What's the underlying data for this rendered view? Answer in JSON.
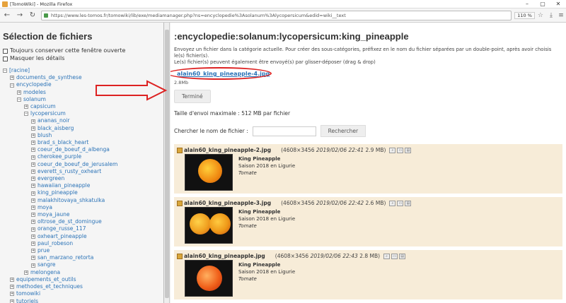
{
  "browser": {
    "title": "[TomoWiki] - Mozilla Firefox",
    "url": "https://www.les-tomos.fr/tomowiki/lib/exe/mediamanager.php?ns=encyclopedie%3Asolanum%3Alycopersicum&edid=wiki__text",
    "zoom": "110 %"
  },
  "left": {
    "title": "Sélection de fichiers",
    "opt1": "Toujours conserver cette fenêtre ouverte",
    "opt2": "Masquer les détails",
    "tree": [
      {
        "label": "[racine]",
        "level": 0,
        "exp": "−"
      },
      {
        "label": "documents_de_synthese",
        "level": 1,
        "exp": "+"
      },
      {
        "label": "encyclopedie",
        "level": 1,
        "exp": "−"
      },
      {
        "label": "modeles",
        "level": 2,
        "exp": "+"
      },
      {
        "label": "solanum",
        "level": 2,
        "exp": "−"
      },
      {
        "label": "capsicum",
        "level": 3,
        "exp": "+"
      },
      {
        "label": "lycopersicum",
        "level": 3,
        "exp": "−"
      },
      {
        "label": "ananas_noir",
        "level": 4,
        "exp": "+"
      },
      {
        "label": "black_aisberg",
        "level": 4,
        "exp": "+"
      },
      {
        "label": "blush",
        "level": 4,
        "exp": "+"
      },
      {
        "label": "brad_s_black_heart",
        "level": 4,
        "exp": "+"
      },
      {
        "label": "coeur_de_boeuf_d_albenga",
        "level": 4,
        "exp": "+"
      },
      {
        "label": "cherokee_purple",
        "level": 4,
        "exp": "+"
      },
      {
        "label": "coeur_de_boeuf_de_jerusalem",
        "level": 4,
        "exp": "+"
      },
      {
        "label": "everett_s_rusty_oxheart",
        "level": 4,
        "exp": "+"
      },
      {
        "label": "evergreen",
        "level": 4,
        "exp": "+"
      },
      {
        "label": "hawaiian_pineapple",
        "level": 4,
        "exp": "+"
      },
      {
        "label": "king_pineapple",
        "level": 4,
        "exp": "+"
      },
      {
        "label": "malakhitovaya_shkatulka",
        "level": 4,
        "exp": "+"
      },
      {
        "label": "moya",
        "level": 4,
        "exp": "+"
      },
      {
        "label": "moya_jaune",
        "level": 4,
        "exp": "+"
      },
      {
        "label": "oltrose_de_st_domingue",
        "level": 4,
        "exp": "+"
      },
      {
        "label": "orange_russe_117",
        "level": 4,
        "exp": "+"
      },
      {
        "label": "oxheart_pineapple",
        "level": 4,
        "exp": "+"
      },
      {
        "label": "paul_robeson",
        "level": 4,
        "exp": "+"
      },
      {
        "label": "prue",
        "level": 4,
        "exp": "+"
      },
      {
        "label": "san_marzano_retorta",
        "level": 4,
        "exp": "+"
      },
      {
        "label": "sangre",
        "level": 4,
        "exp": "+"
      },
      {
        "label": "melongena",
        "level": 3,
        "exp": "+"
      },
      {
        "label": "equipements_et_outils",
        "level": 1,
        "exp": "+"
      },
      {
        "label": "methodes_et_techniques",
        "level": 1,
        "exp": "+"
      },
      {
        "label": "tomowiki",
        "level": 1,
        "exp": "+"
      },
      {
        "label": "tutoriels",
        "level": 1,
        "exp": "+"
      },
      {
        "label": "wiki",
        "level": 1,
        "exp": "+"
      }
    ]
  },
  "main": {
    "title": ":encyclopedie:solanum:lycopersicum:king_pineapple",
    "info1": "Envoyez un fichier dans la catégorie actuelle. Pour créer des sous-catégories, préfixez en le nom du fichier séparées par un double-point, après avoir choisis le(s) fichier(s).",
    "info2": "Le(s) fichier(s) peuvent également être envoyé(s) par glisser-déposer (drag & drop)",
    "uploaded_file": "alain60_king_pineapple-4.jpg",
    "uploaded_size": "2.8Mb",
    "done_label": "Terminé",
    "max_size": "Taille d'envoi maximale : 512 MB par fichier",
    "search_label": "Chercher le nom de fichier :",
    "search_button": "Rechercher",
    "results": [
      {
        "name": "alain60_king_pineapple-2.jpg",
        "dims": "(4608×3456",
        "date": "2019/02/06 22:41",
        "size": "2.9 MB)",
        "title": "King Pineapple",
        "line2": "Saison 2018 en Ligurie",
        "line3": "Tomate"
      },
      {
        "name": "alain60_king_pineapple-3.jpg",
        "dims": "(4608×3456",
        "date": "2019/02/06 22:42",
        "size": "2.6 MB)",
        "title": "King Pineapple",
        "line2": "Saison 2018 en Ligurie",
        "line3": "Tomate"
      },
      {
        "name": "alain60_king_pineapple.jpg",
        "dims": "(4608×3456",
        "date": "2019/02/06 22:43",
        "size": "2.8 MB)",
        "title": "King Pineapple",
        "line2": "Saison 2018 en Ligurie",
        "line3": "Tomate"
      }
    ]
  },
  "colors": {
    "link": "#2b73b7",
    "highlight": "#d22222",
    "result_bg": "#f7ecd8"
  }
}
